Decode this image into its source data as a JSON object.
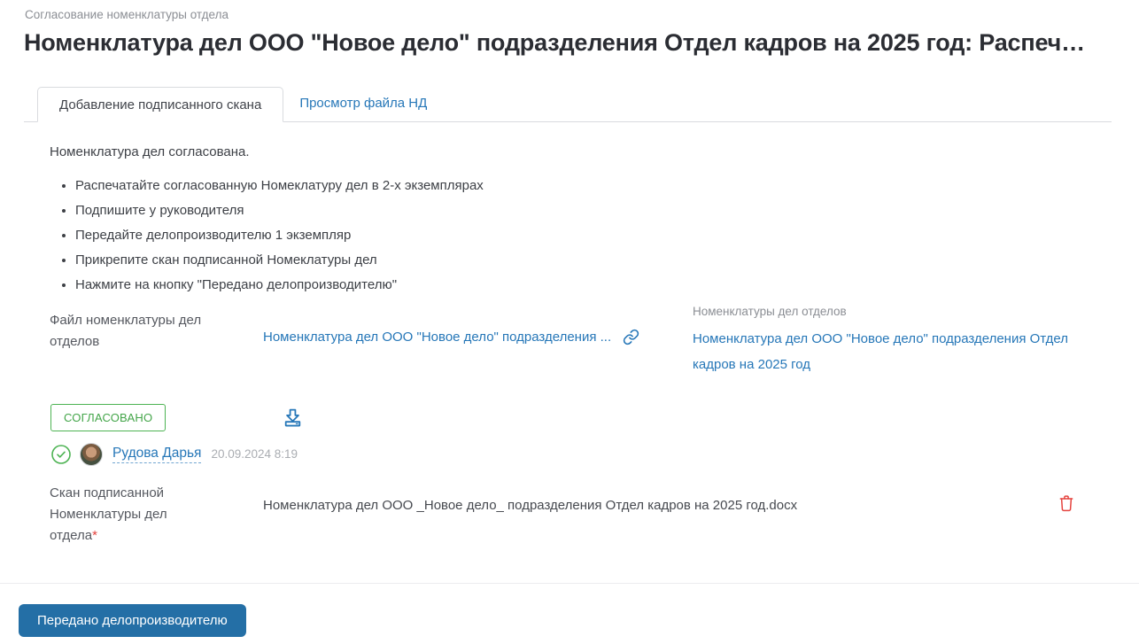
{
  "breadcrumb": "Согласование номенклатуры отдела",
  "page_title": "Номенклатура дел ООО \"Новое дело\" подразделения Отдел кадров на 2025 год: Распеч…",
  "tabs": [
    {
      "label": "Добавление подписанного скана",
      "active": true
    },
    {
      "label": "Просмотр файла НД",
      "active": false
    }
  ],
  "intro": "Номенклатура дел согласована.",
  "instructions": [
    "Распечатайте согласованную Номеклатуру дел в 2-х экземплярах",
    "Подпишите у руководителя",
    "Передайте делопроизводителю 1 экземпляр",
    "Прикрепите скан подписанной Номеклатуры дел",
    "Нажмите на кнопку \"Передано делопроизводителю\""
  ],
  "file_field": {
    "label": "Файл номенклатуры дел отделов",
    "link_text": "Номенклатура дел ООО \"Новое дело\" подразделения ...",
    "link_icon": "chain-link-icon"
  },
  "related": {
    "caption": "Номенклатуры дел отделов",
    "link_text": "Номенклатура дел ООО \"Новое дело\" подразделения Отдел кадров на 2025 год"
  },
  "status": {
    "badge": "СОГЛАСОВАНО",
    "stamp_icon": "stamp-icon"
  },
  "approval": {
    "check_icon": "check-circle-icon",
    "user_name": "Рудова Дарья",
    "timestamp": "20.09.2024 8:19"
  },
  "scan_field": {
    "label": "Скан подписанной Номенклатуры дел отдела",
    "required_mark": "*",
    "filename": "Номенклатура дел ООО _Новое дело_ подразделения Отдел кадров на 2025 год.docx",
    "delete_icon": "trash-icon"
  },
  "footer": {
    "submit_label": "Передано делопроизводителю"
  },
  "colors": {
    "accent_blue": "#2677b8",
    "success_green": "#4db353",
    "danger_red": "#e5433e",
    "button_blue": "#246fa6",
    "title_text": "#2b2d33",
    "muted_text": "#8b8e94"
  }
}
